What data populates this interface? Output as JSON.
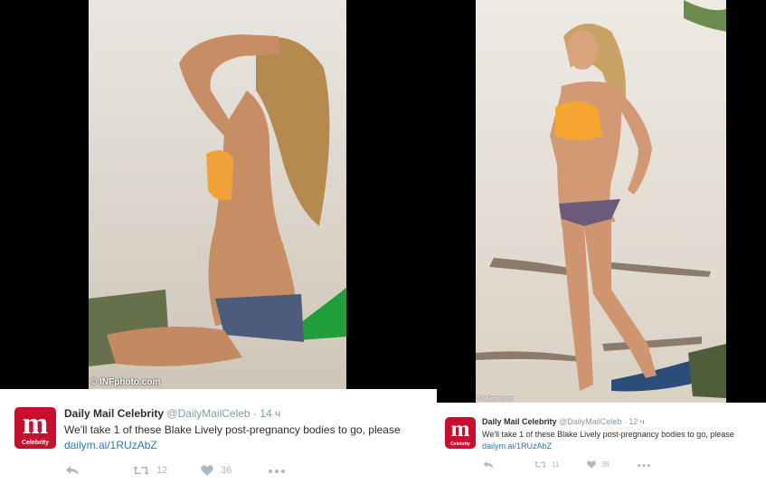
{
  "left": {
    "photo_credit": "© INFphoto.com",
    "tweet": {
      "display_name": "Daily Mail Celebrity",
      "handle": "@DailyMailCeleb",
      "separator": "·",
      "time": "14 ч",
      "text": "We'll take 1 of these Blake Lively post-pregnancy bodies to go, please",
      "link": "dailym.ai/1RUzAbZ",
      "retweet_count": "12",
      "like_count": "36",
      "logo_letter": "m",
      "logo_sub": "Celebrity"
    }
  },
  "right": {
    "photo_credit": "© INFphoto.com",
    "tweet": {
      "display_name": "Daily Mail Celebrity",
      "handle": "@DailyMailCeleb",
      "separator": "·",
      "time": "12 ч",
      "text": "We'll take 1 of these Blake Lively post-pregnancy bodies to go, please",
      "link": "dailym.ai/1RUzAbZ",
      "retweet_count": "11",
      "like_count": "36",
      "logo_letter": "m",
      "logo_sub": "Celebrity"
    }
  },
  "icons": [
    "reply-icon",
    "retweet-icon",
    "heart-icon",
    "more-icon"
  ],
  "colors": {
    "brand": "#c8102e",
    "link": "#2b7bb9",
    "icon": "#aab8c2",
    "name": "#292f33",
    "meta": "#8899a6"
  }
}
